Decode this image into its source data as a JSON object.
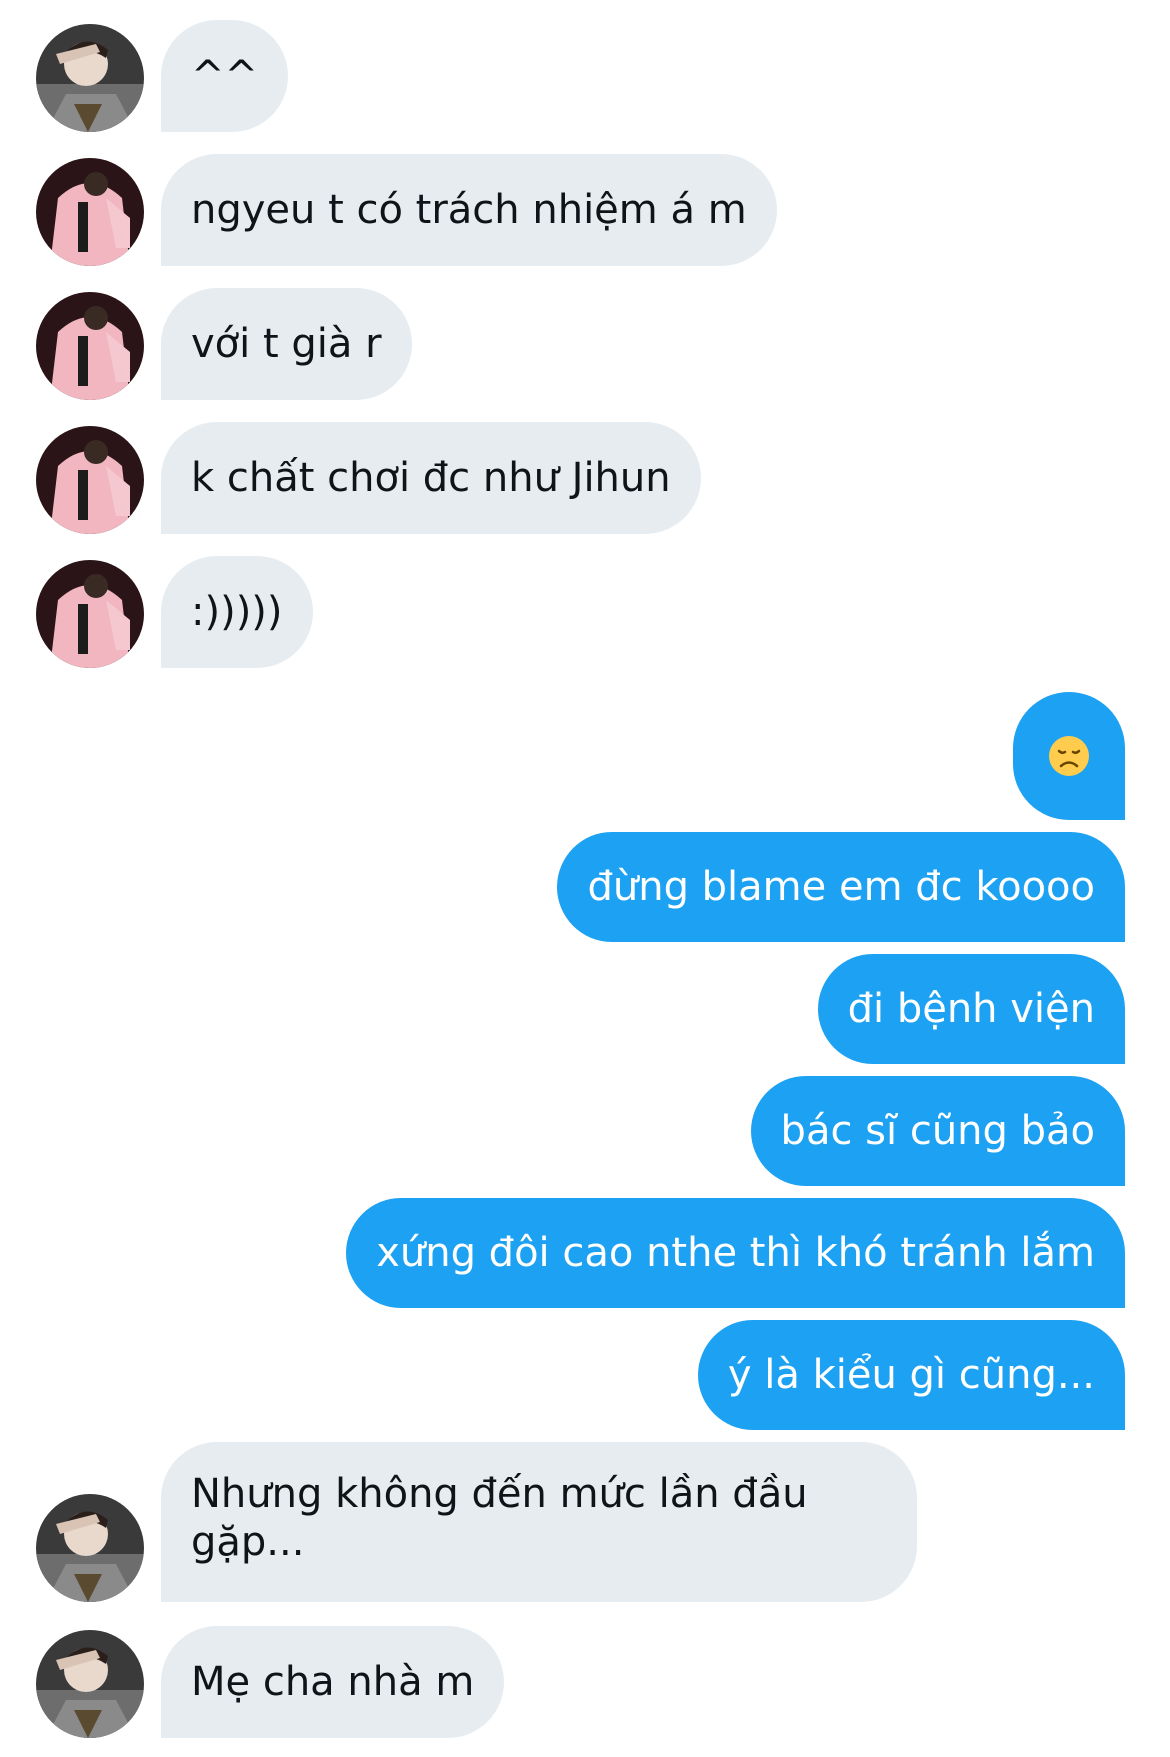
{
  "conversation": {
    "messages": [
      {
        "side": "in",
        "avatar": "avatar-gray-jacket",
        "text": "^^"
      },
      {
        "side": "in",
        "avatar": "avatar-pink-jacket",
        "text": "ngyeu t có trách nhiệm á m"
      },
      {
        "side": "in",
        "avatar": "avatar-pink-jacket",
        "text": "với t già r"
      },
      {
        "side": "in",
        "avatar": "avatar-pink-jacket",
        "text": "k chất chơi đc như Jihun"
      },
      {
        "side": "in",
        "avatar": "avatar-pink-jacket",
        "text": ":)))))"
      },
      {
        "side": "out",
        "emoji": "disappointed-face-emoji"
      },
      {
        "side": "out",
        "text": "đừng blame em đc koooo"
      },
      {
        "side": "out",
        "text": "đi bệnh viện"
      },
      {
        "side": "out",
        "text": "bác sĩ cũng bảo"
      },
      {
        "side": "out",
        "text": "xứng đôi cao nthe thì khó tránh lắm"
      },
      {
        "side": "out",
        "text": "ý là kiểu gì cũng..."
      },
      {
        "side": "in",
        "avatar": "avatar-gray-jacket",
        "text": "Nhưng không đến mức lần đầu gặp..."
      },
      {
        "side": "in",
        "avatar": "avatar-gray-jacket",
        "text": "Mẹ cha nhà m"
      }
    ]
  },
  "colors": {
    "incoming_bubble": "#e6ecf0",
    "outgoing_bubble": "#1da1f2",
    "incoming_text": "#0f1419",
    "outgoing_text": "#ffffff"
  }
}
